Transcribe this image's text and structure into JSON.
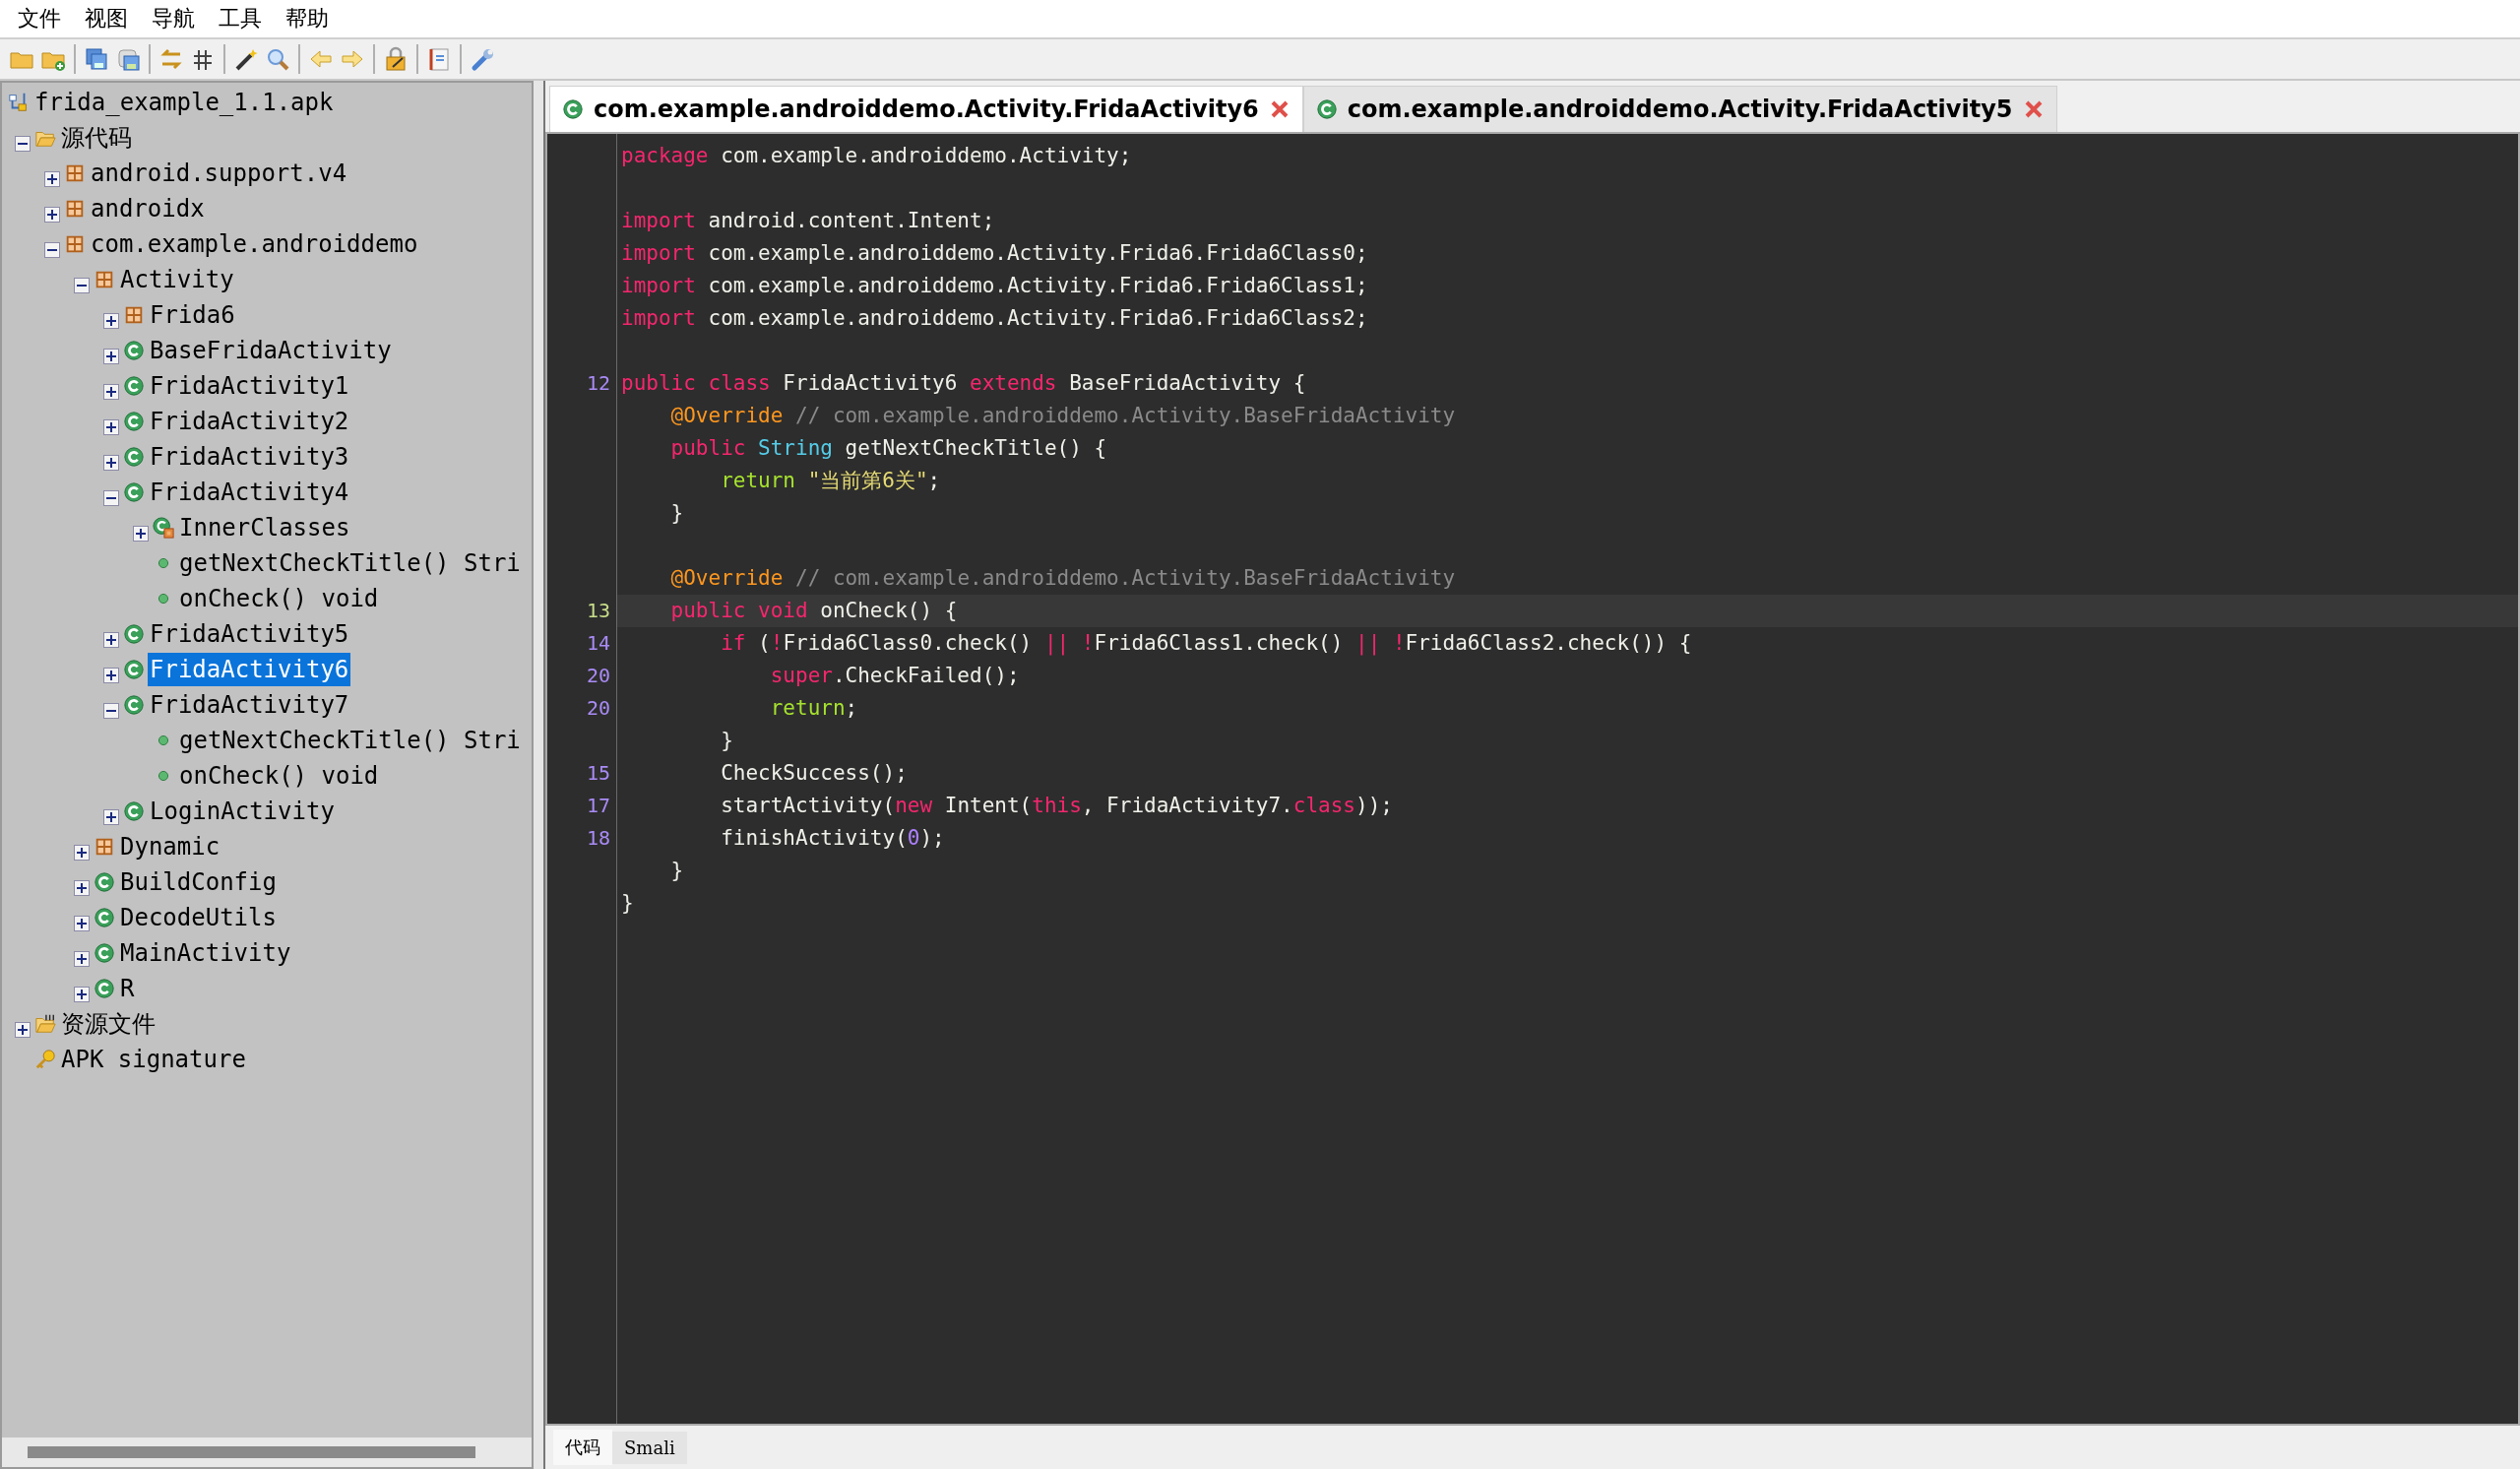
{
  "menu": [
    "文件",
    "视图",
    "导航",
    "工具",
    "帮助"
  ],
  "tree": {
    "label": "frida_example_1.1.apk",
    "kind": "apk",
    "selected": false,
    "children": [
      {
        "label": "源代码",
        "kind": "folder",
        "expanded": true,
        "selected": false,
        "children": [
          {
            "label": "android.support.v4",
            "kind": "package",
            "expanded": false,
            "selected": false
          },
          {
            "label": "androidx",
            "kind": "package",
            "expanded": false,
            "selected": false
          },
          {
            "label": "com.example.androiddemo",
            "kind": "package",
            "expanded": true,
            "selected": false,
            "children": [
              {
                "label": "Activity",
                "kind": "package",
                "expanded": true,
                "selected": false,
                "children": [
                  {
                    "label": "Frida6",
                    "kind": "package",
                    "expanded": false,
                    "selected": false
                  },
                  {
                    "label": "BaseFridaActivity",
                    "kind": "class",
                    "expanded": false,
                    "selected": false
                  },
                  {
                    "label": "FridaActivity1",
                    "kind": "class",
                    "expanded": false,
                    "selected": false
                  },
                  {
                    "label": "FridaActivity2",
                    "kind": "class",
                    "expanded": false,
                    "selected": false
                  },
                  {
                    "label": "FridaActivity3",
                    "kind": "class",
                    "expanded": false,
                    "selected": false
                  },
                  {
                    "label": "FridaActivity4",
                    "kind": "class",
                    "expanded": true,
                    "selected": false,
                    "children": [
                      {
                        "label": "InnerClasses",
                        "kind": "inner",
                        "expanded": false,
                        "selected": false
                      },
                      {
                        "label": "getNextCheckTitle() Stri",
                        "kind": "method",
                        "selected": false
                      },
                      {
                        "label": "onCheck() void",
                        "kind": "method",
                        "selected": false
                      }
                    ]
                  },
                  {
                    "label": "FridaActivity5",
                    "kind": "class",
                    "expanded": false,
                    "selected": false
                  },
                  {
                    "label": "FridaActivity6",
                    "kind": "class",
                    "expanded": false,
                    "selected": true
                  },
                  {
                    "label": "FridaActivity7",
                    "kind": "class",
                    "expanded": true,
                    "selected": false,
                    "children": [
                      {
                        "label": "getNextCheckTitle() Stri",
                        "kind": "method",
                        "selected": false
                      },
                      {
                        "label": "onCheck() void",
                        "kind": "method",
                        "selected": false
                      }
                    ]
                  },
                  {
                    "label": "LoginActivity",
                    "kind": "class",
                    "expanded": false,
                    "selected": false
                  }
                ]
              },
              {
                "label": "Dynamic",
                "kind": "package",
                "expanded": false,
                "selected": false
              },
              {
                "label": "BuildConfig",
                "kind": "class",
                "expanded": false,
                "selected": false
              },
              {
                "label": "DecodeUtils",
                "kind": "class",
                "expanded": false,
                "selected": false
              },
              {
                "label": "MainActivity",
                "kind": "class",
                "expanded": false,
                "selected": false
              },
              {
                "label": "R",
                "kind": "class",
                "expanded": false,
                "selected": false
              }
            ]
          }
        ]
      },
      {
        "label": "资源文件",
        "kind": "resources",
        "expanded": false,
        "selected": false
      },
      {
        "label": "APK signature",
        "kind": "key",
        "selected": false
      }
    ]
  },
  "editor_tabs": [
    {
      "label": "com.example.androiddemo.Activity.FridaActivity6",
      "selected": true
    },
    {
      "label": "com.example.androiddemo.Activity.FridaActivity5",
      "selected": false
    }
  ],
  "code_lines": [
    {
      "kind": "code",
      "tokens": [
        {
          "kind": "keyword",
          "text": "package"
        },
        {
          "kind": "plain",
          "text": " com.example.androiddemo.Activity;"
        }
      ]
    },
    {
      "kind": "blank"
    },
    {
      "kind": "code",
      "tokens": [
        {
          "kind": "keyword",
          "text": "import"
        },
        {
          "kind": "plain",
          "text": " android.content.Intent;"
        }
      ]
    },
    {
      "kind": "code",
      "tokens": [
        {
          "kind": "keyword",
          "text": "import"
        },
        {
          "kind": "plain",
          "text": " com.example.androiddemo.Activity.Frida6.Frida6Class0;"
        }
      ]
    },
    {
      "kind": "code",
      "tokens": [
        {
          "kind": "keyword",
          "text": "import"
        },
        {
          "kind": "plain",
          "text": " com.example.androiddemo.Activity.Frida6.Frida6Class1;"
        }
      ]
    },
    {
      "kind": "code",
      "tokens": [
        {
          "kind": "keyword",
          "text": "import"
        },
        {
          "kind": "plain",
          "text": " com.example.androiddemo.Activity.Frida6.Frida6Class2;"
        }
      ]
    },
    {
      "kind": "blank"
    },
    {
      "kind": "code",
      "number": "12",
      "tokens": [
        {
          "kind": "keyword",
          "text": "public class"
        },
        {
          "kind": "plain",
          "text": " FridaActivity6 "
        },
        {
          "kind": "keyword",
          "text": "extends"
        },
        {
          "kind": "plain",
          "text": " BaseFridaActivity {"
        }
      ]
    },
    {
      "kind": "code",
      "tokens": [
        {
          "kind": "annotation",
          "text": "    @Override"
        },
        {
          "kind": "comment",
          "text": " // com.example.androiddemo.Activity.BaseFridaActivity"
        }
      ]
    },
    {
      "kind": "code",
      "tokens": [
        {
          "kind": "keyword",
          "text": "    public"
        },
        {
          "kind": "type",
          "text": " String"
        },
        {
          "kind": "plain",
          "text": " getNextCheckTitle() {"
        }
      ]
    },
    {
      "kind": "code",
      "tokens": [
        {
          "kind": "control",
          "text": "        return"
        },
        {
          "kind": "string",
          "text": " \"当前第6关\""
        },
        {
          "kind": "plain",
          "text": ";"
        }
      ]
    },
    {
      "kind": "code",
      "tokens": [
        {
          "kind": "plain",
          "text": "    }"
        }
      ]
    },
    {
      "kind": "blank"
    },
    {
      "kind": "code",
      "tokens": [
        {
          "kind": "annotation",
          "text": "    @Override"
        },
        {
          "kind": "comment",
          "text": " // com.example.androiddemo.Activity.BaseFridaActivity"
        }
      ]
    },
    {
      "kind": "code",
      "number": "13",
      "current": true,
      "tokens": [
        {
          "kind": "keyword",
          "text": "    public void"
        },
        {
          "kind": "plain",
          "text": " onCheck() {"
        }
      ]
    },
    {
      "kind": "code",
      "number": "14",
      "tokens": [
        {
          "kind": "keyword",
          "text": "        if"
        },
        {
          "kind": "plain",
          "text": " ("
        },
        {
          "kind": "keyword",
          "text": "!"
        },
        {
          "kind": "plain",
          "text": "Frida6Class0.check() "
        },
        {
          "kind": "keyword",
          "text": "|| !"
        },
        {
          "kind": "plain",
          "text": "Frida6Class1.check() "
        },
        {
          "kind": "keyword",
          "text": "|| !"
        },
        {
          "kind": "plain",
          "text": "Frida6Class2.check()) {"
        }
      ]
    },
    {
      "kind": "code",
      "number": "20",
      "tokens": [
        {
          "kind": "keyword",
          "text": "            super"
        },
        {
          "kind": "plain",
          "text": ".CheckFailed();"
        }
      ]
    },
    {
      "kind": "code",
      "number": "20",
      "tokens": [
        {
          "kind": "control",
          "text": "            return"
        },
        {
          "kind": "plain",
          "text": ";"
        }
      ]
    },
    {
      "kind": "code",
      "tokens": [
        {
          "kind": "plain",
          "text": "        }"
        }
      ]
    },
    {
      "kind": "code",
      "number": "15",
      "tokens": [
        {
          "kind": "plain",
          "text": "        CheckSuccess();"
        }
      ]
    },
    {
      "kind": "code",
      "number": "17",
      "tokens": [
        {
          "kind": "plain",
          "text": "        startActivity("
        },
        {
          "kind": "keyword",
          "text": "new"
        },
        {
          "kind": "plain",
          "text": " Intent("
        },
        {
          "kind": "keyword",
          "text": "this"
        },
        {
          "kind": "plain",
          "text": ", FridaActivity7."
        },
        {
          "kind": "keyword",
          "text": "class"
        },
        {
          "kind": "plain",
          "text": "));"
        }
      ]
    },
    {
      "kind": "code",
      "number": "18",
      "tokens": [
        {
          "kind": "plain",
          "text": "        finishActivity("
        },
        {
          "kind": "number",
          "text": "0"
        },
        {
          "kind": "plain",
          "text": ");"
        }
      ]
    },
    {
      "kind": "code",
      "tokens": [
        {
          "kind": "plain",
          "text": "    }"
        }
      ]
    },
    {
      "kind": "code",
      "tokens": [
        {
          "kind": "plain",
          "text": "}"
        }
      ]
    }
  ],
  "view_tabs": [
    {
      "label": "代码",
      "selected": true
    },
    {
      "label": "Smali",
      "selected": false
    }
  ]
}
